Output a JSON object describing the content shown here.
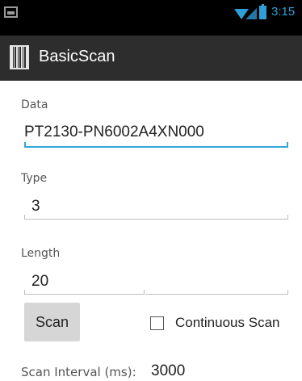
{
  "status_bar": {
    "time": "3:15",
    "icons": [
      "image-notification-icon",
      "wifi-icon",
      "signal-icon",
      "battery-icon"
    ]
  },
  "action_bar": {
    "title": "BasicScan",
    "icon": "barcode-icon"
  },
  "form": {
    "data": {
      "label": "Data",
      "value": "PT2130-PN6002A4XN000"
    },
    "type": {
      "label": "Type",
      "value": "3"
    },
    "length": {
      "label": "Length",
      "value": "20"
    }
  },
  "controls": {
    "scan_button_label": "Scan",
    "continuous_scan": {
      "label": "Continuous Scan",
      "checked": false
    }
  },
  "interval": {
    "label": "Scan Interval (ms):",
    "value": "3000"
  },
  "colors": {
    "status_bar_bg": "#000000",
    "action_bar_bg": "#2d2d2d",
    "accent": "#33a6d8",
    "button_bg": "#d6d6d6"
  }
}
